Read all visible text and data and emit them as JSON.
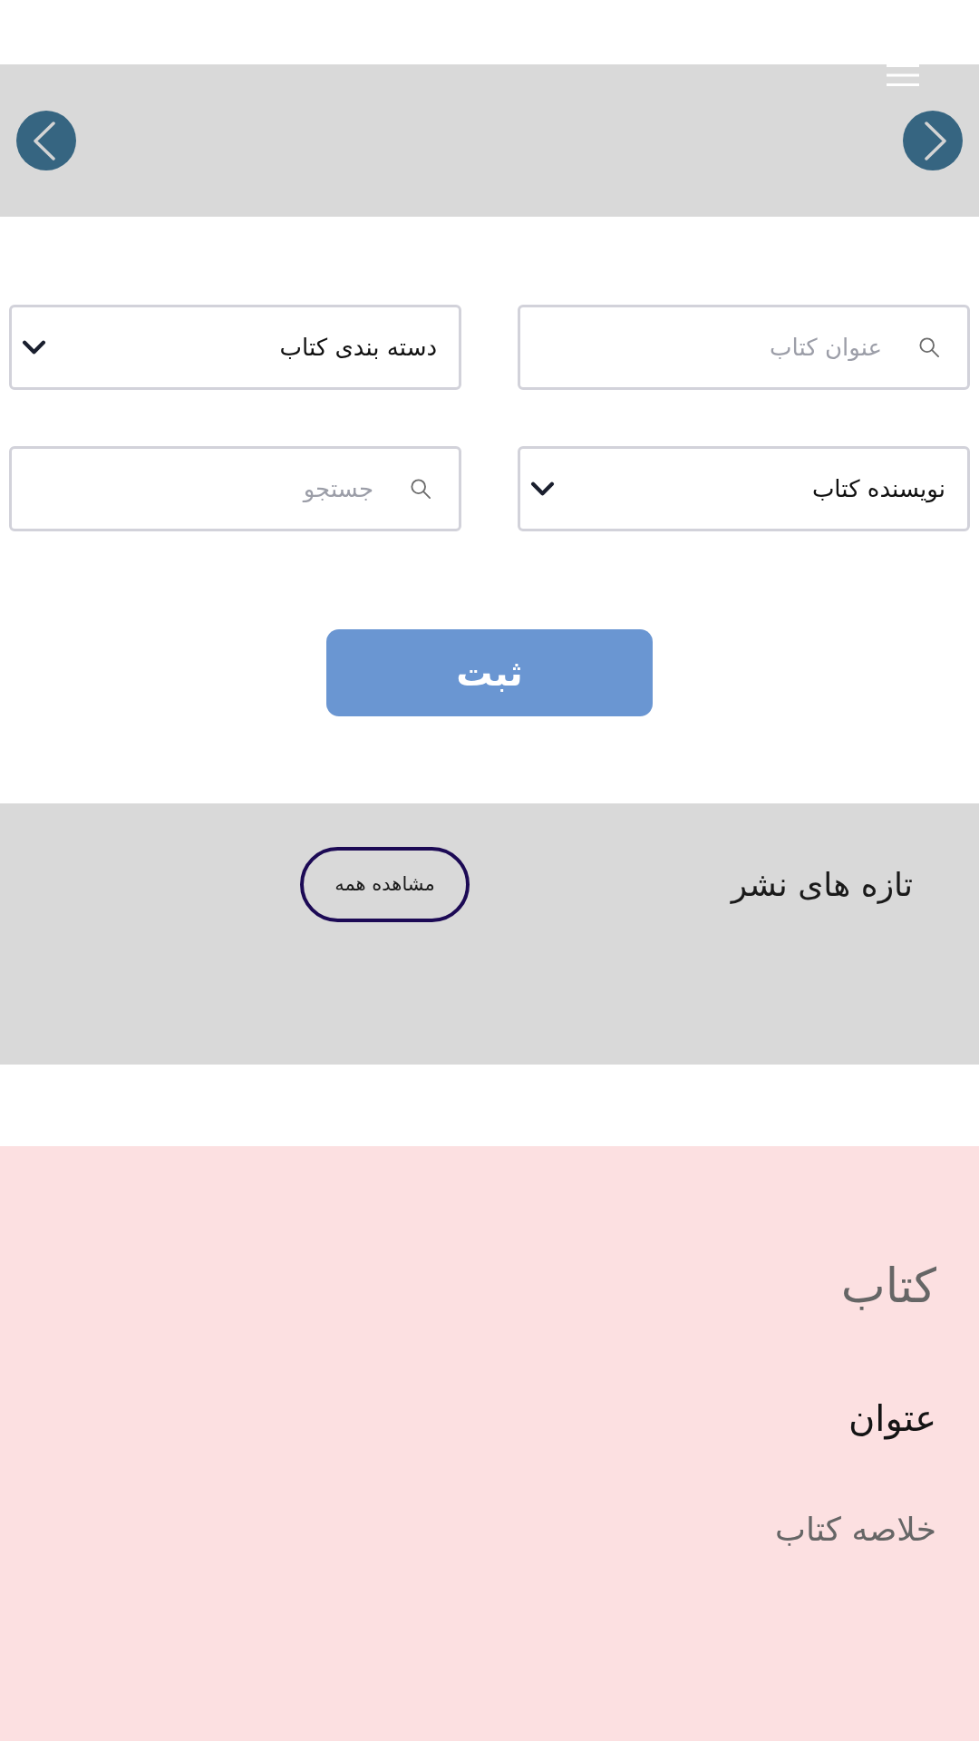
{
  "search_form": {
    "fields": [
      {
        "kind": "search",
        "placeholder": "عنوان کتاب"
      },
      {
        "kind": "select",
        "value": "دسته بندی کتاب"
      },
      {
        "kind": "select",
        "value": "نویسنده کتاب"
      },
      {
        "kind": "search",
        "placeholder": "جستجو"
      }
    ],
    "submit_button": "ثبت"
  },
  "new_releases": {
    "title": "تازه های نشر",
    "view_all_button": "مشاهده همه"
  },
  "book": {
    "heading": "کتاب",
    "title": "عتوان",
    "summary": "خلاصه کتاب"
  }
}
